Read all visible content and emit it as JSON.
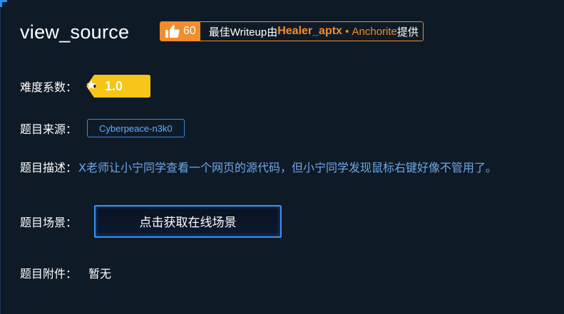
{
  "challenge": {
    "title": "view_source"
  },
  "writeup_badge": {
    "likes": "60",
    "prefix": "最佳Writeup由",
    "author": "Healer_aptx",
    "separator": " • ",
    "team": "Anchorite",
    "suffix": "提供"
  },
  "difficulty": {
    "label": "难度系数：",
    "value": "1.0"
  },
  "source": {
    "label": "题目来源：",
    "value": "Cyberpeace-n3k0"
  },
  "description": {
    "label": "题目描述：",
    "value": "X老师让小宁同学查看一个网页的源代码，但小宁同学发现鼠标右键好像不管用了。"
  },
  "scene": {
    "label": "题目场景：",
    "button_label": "点击获取在线场景"
  },
  "attachment": {
    "label": "题目附件：",
    "value": "暂无"
  },
  "colors": {
    "background": "#0f1a27",
    "accent_orange": "#f08d2d",
    "accent_blue": "#2f8cf0",
    "difficulty_yellow": "#f5c518",
    "description_blue": "#6ea8e8"
  }
}
